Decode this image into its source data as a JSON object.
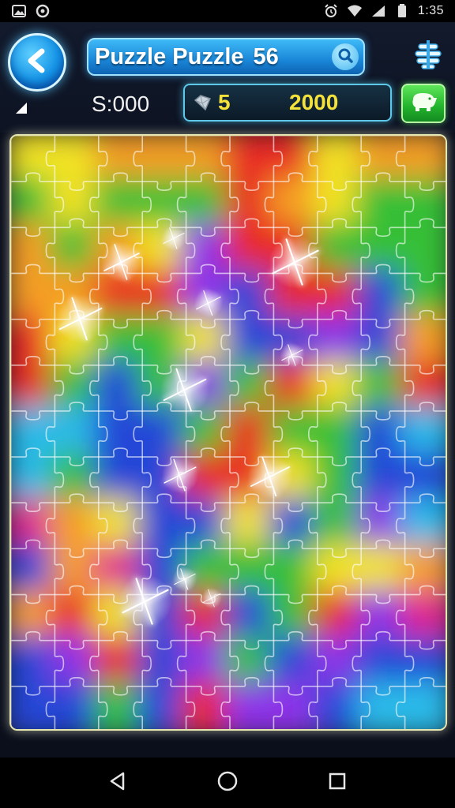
{
  "status_bar": {
    "time": "1:35",
    "left_icons": [
      "image-icon",
      "shield-icon"
    ],
    "right_icons": [
      "alarm-icon",
      "wifi-icon",
      "signal-icon",
      "battery-icon"
    ]
  },
  "header": {
    "title": "Puzzle Puzzle",
    "level": "56",
    "score": "S:000",
    "coins": "5",
    "coin_total": "2000"
  },
  "icons": {
    "back": "back-arrow-icon",
    "search": "search-icon",
    "menu": "menu-list-icon",
    "gem": "gem-icon",
    "shop": "piggy-bank-icon"
  },
  "board": {
    "rows": 13,
    "cols": 10,
    "palette": [
      "#f2e21a",
      "#f59a1c",
      "#e8241c",
      "#2ebd2e",
      "#1b3fd6",
      "#8a2be8",
      "#e01f8a",
      "#22b8e8"
    ],
    "colors": [
      [
        "#f2e21a",
        "#f2e21a",
        "#f59a1c",
        "#f59a1c",
        "#f59a1c",
        "#e8241c",
        "#e8241c",
        "#f2e21a",
        "#f59a1c",
        "#f59a1c"
      ],
      [
        "#2ebd2e",
        "#f2e21a",
        "#2ebd2e",
        "#2ebd2e",
        "#2ebd2e",
        "#e8241c",
        "#f59a1c",
        "#f2e21a",
        "#2ebd2e",
        "#2ebd2e"
      ],
      [
        "#f59a1c",
        "#2ebd2e",
        "#f59a1c",
        "#f2e21a",
        "#8a2be8",
        "#e8241c",
        "#e8241c",
        "#2ebd2e",
        "#2ebd2e",
        "#2ebd2e"
      ],
      [
        "#f59a1c",
        "#f59a1c",
        "#e8241c",
        "#e8241c",
        "#8a2be8",
        "#1b3fd6",
        "#e8241c",
        "#e8241c",
        "#1b3fd6",
        "#2ebd2e"
      ],
      [
        "#e8241c",
        "#f2e21a",
        "#2ebd2e",
        "#2ebd2e",
        "#f2e21a",
        "#1b3fd6",
        "#1b3fd6",
        "#8a2be8",
        "#1b3fd6",
        "#f59a1c"
      ],
      [
        "#e8241c",
        "#2ebd2e",
        "#1b3fd6",
        "#2ebd2e",
        "#8a2be8",
        "#2ebd2e",
        "#e8241c",
        "#f2e21a",
        "#2ebd2e",
        "#e8241c"
      ],
      [
        "#22b8e8",
        "#22b8e8",
        "#1b3fd6",
        "#1b3fd6",
        "#2ebd2e",
        "#e8241c",
        "#2ebd2e",
        "#2ebd2e",
        "#1b3fd6",
        "#22b8e8"
      ],
      [
        "#22b8e8",
        "#2ebd2e",
        "#1b3fd6",
        "#1b3fd6",
        "#e8241c",
        "#e8241c",
        "#f2e21a",
        "#2ebd2e",
        "#1b3fd6",
        "#1b3fd6"
      ],
      [
        "#e01f8a",
        "#f59a1c",
        "#f2e21a",
        "#1b3fd6",
        "#1b3fd6",
        "#f2e21a",
        "#1b3fd6",
        "#2ebd2e",
        "#8a2be8",
        "#22b8e8"
      ],
      [
        "#1b3fd6",
        "#f59a1c",
        "#e01f8a",
        "#1b3fd6",
        "#2ebd2e",
        "#2ebd2e",
        "#2ebd2e",
        "#f2e21a",
        "#f2e21a",
        "#f59a1c"
      ],
      [
        "#f59a1c",
        "#e8241c",
        "#f2e21a",
        "#1b3fd6",
        "#e8241c",
        "#1b3fd6",
        "#2ebd2e",
        "#e8241c",
        "#8a2be8",
        "#e01f8a"
      ],
      [
        "#1b3fd6",
        "#8a2be8",
        "#e8241c",
        "#1b3fd6",
        "#8a2be8",
        "#2ebd2e",
        "#1b3fd6",
        "#8a2be8",
        "#1b3fd6",
        "#1b3fd6"
      ],
      [
        "#1b3fd6",
        "#1b3fd6",
        "#2ebd2e",
        "#1b3fd6",
        "#e8241c",
        "#8a2be8",
        "#8a2be8",
        "#1b3fd6",
        "#22b8e8",
        "#22b8e8"
      ]
    ]
  },
  "nav_bar": {
    "buttons": [
      "back-triangle-icon",
      "home-circle-icon",
      "recents-square-icon"
    ]
  }
}
